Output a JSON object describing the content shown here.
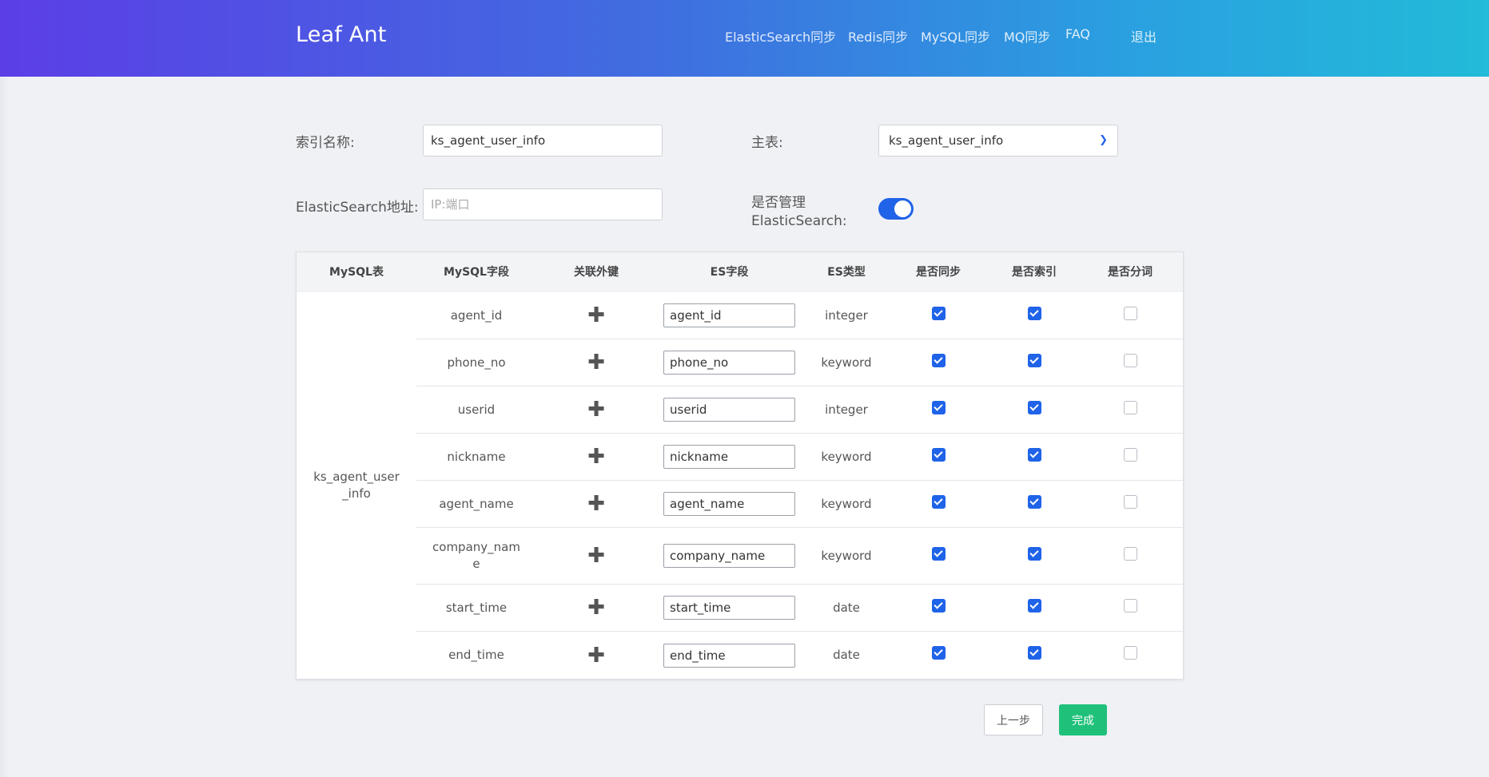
{
  "header": {
    "brand": "Leaf Ant",
    "nav": [
      "ElasticSearch同步",
      "Redis同步",
      "MySQL同步",
      "MQ同步",
      "FAQ"
    ],
    "logout": "退出"
  },
  "form": {
    "index_name_label": "索引名称:",
    "index_name_value": "ks_agent_user_info",
    "main_table_label": "主表:",
    "main_table_value": "ks_agent_user_info",
    "es_address_label": "ElasticSearch地址:",
    "es_address_placeholder": "IP:端口",
    "manage_es_label_line1": "是否管理",
    "manage_es_label_line2": "ElasticSearch:",
    "manage_es_enabled": true
  },
  "table": {
    "headers": [
      "MySQL表",
      "MySQL字段",
      "关联外键",
      "ES字段",
      "ES类型",
      "是否同步",
      "是否索引",
      "是否分词"
    ],
    "mysql_table": "ks_agent_user_info",
    "rows": [
      {
        "field": "agent_id",
        "es_field": "agent_id",
        "es_type": "integer",
        "sync": true,
        "index": true,
        "analyze": false
      },
      {
        "field": "phone_no",
        "es_field": "phone_no",
        "es_type": "keyword",
        "sync": true,
        "index": true,
        "analyze": false
      },
      {
        "field": "userid",
        "es_field": "userid",
        "es_type": "integer",
        "sync": true,
        "index": true,
        "analyze": false
      },
      {
        "field": "nickname",
        "es_field": "nickname",
        "es_type": "keyword",
        "sync": true,
        "index": true,
        "analyze": false
      },
      {
        "field": "agent_name",
        "es_field": "agent_name",
        "es_type": "keyword",
        "sync": true,
        "index": true,
        "analyze": false
      },
      {
        "field": "company_name",
        "es_field": "company_name",
        "es_type": "keyword",
        "sync": true,
        "index": true,
        "analyze": false
      },
      {
        "field": "start_time",
        "es_field": "start_time",
        "es_type": "date",
        "sync": true,
        "index": true,
        "analyze": false
      },
      {
        "field": "end_time",
        "es_field": "end_time",
        "es_type": "date",
        "sync": true,
        "index": true,
        "analyze": false
      }
    ]
  },
  "buttons": {
    "prev": "上一步",
    "done": "完成"
  },
  "icons": {
    "add_foreign_key": "plus-icon",
    "select_chevron": "chevron-down-icon"
  },
  "colors": {
    "header_gradient_start": "#5b3ee6",
    "header_gradient_end": "#22bbd8",
    "accent": "#1f63e8",
    "done_button": "#1fc07a"
  }
}
